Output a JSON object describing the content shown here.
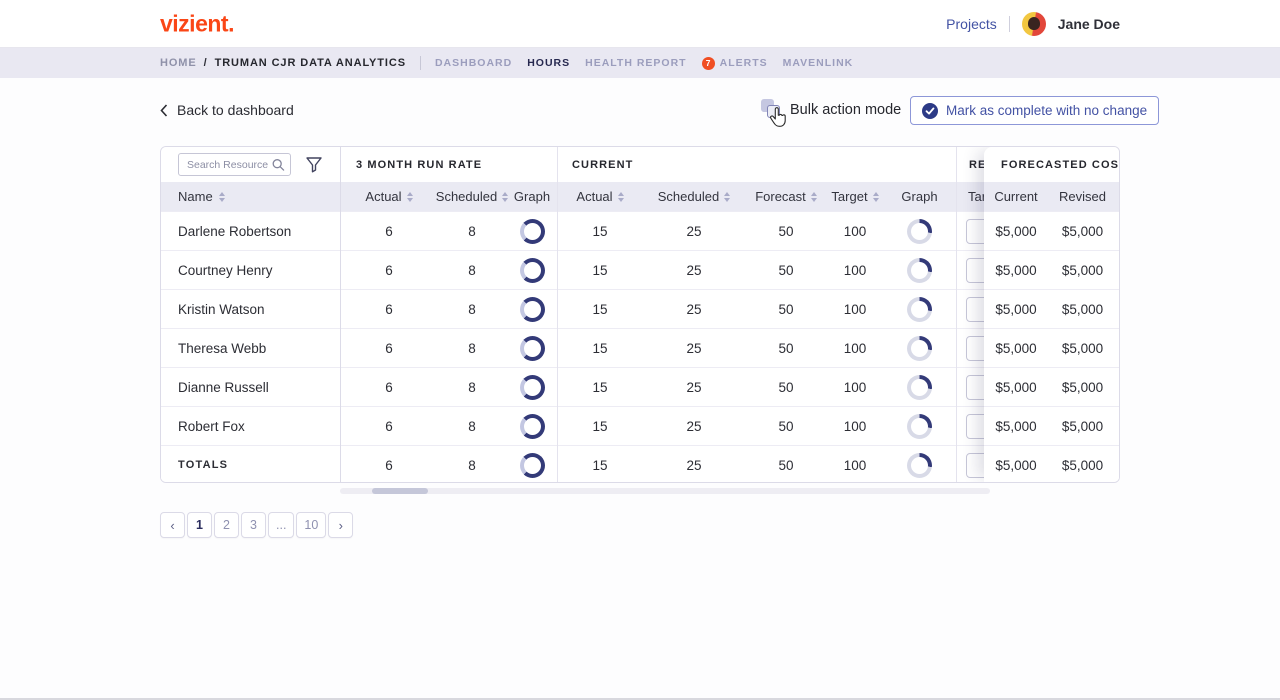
{
  "colors": {
    "brand_orange": "#fa4616",
    "badge_orange": "#f04e23",
    "accent_blue": "#4352a4",
    "active_nav": "#26284f",
    "donut_dark": "#333a78",
    "donut_light_rr": "#c3c7e2",
    "donut_light_cur": "#d8dae7",
    "header_lavender": "#eaeaf3",
    "subnav_lavender": "#e9e8f2"
  },
  "brand": {
    "logo": "vizient."
  },
  "topbar": {
    "projects": "Projects",
    "user": "Jane Doe"
  },
  "breadcrumb": {
    "home": "HOME",
    "separator": "/",
    "current": "TRUMAN CJR DATA ANALYTICS"
  },
  "nav": {
    "tabs": [
      {
        "label": "DASHBOARD"
      },
      {
        "label": "HOURS",
        "active": true
      },
      {
        "label": "HEALTH REPORT"
      },
      {
        "label": "ALERTS",
        "badge": "7"
      },
      {
        "label": "MAVENLINK"
      }
    ]
  },
  "toolbar": {
    "back_label": "Back to dashboard",
    "bulk_label": "Bulk action mode",
    "help_glyph": "?",
    "complete_label": "Mark as complete with no change"
  },
  "table": {
    "search_placeholder": "Search Resources",
    "name_header": "Name",
    "groups": {
      "run_rate": "3 MONTH RUN RATE",
      "current": "CURRENT",
      "revised": "REVISED",
      "forecasted_cost": "FORECASTED COST"
    },
    "mid_columns": [
      {
        "key": "rr_actual",
        "label": "Actual",
        "sortable": true
      },
      {
        "key": "rr_scheduled",
        "label": "Scheduled",
        "sortable": true
      },
      {
        "key": "rr_graph",
        "label": "Graph",
        "type": "donut_rr"
      },
      {
        "key": "cur_actual",
        "label": "Actual",
        "sortable": true
      },
      {
        "key": "cur_scheduled",
        "label": "Scheduled",
        "sortable": true
      },
      {
        "key": "cur_forecast",
        "label": "Forecast",
        "sortable": true
      },
      {
        "key": "cur_target",
        "label": "Target",
        "sortable": true
      },
      {
        "key": "cur_graph",
        "label": "Graph",
        "type": "donut_cur"
      },
      {
        "key": "rev_target",
        "label": "Target",
        "type": "input"
      }
    ],
    "panel_columns": [
      {
        "key": "cost_current",
        "label": "Current"
      },
      {
        "key": "cost_revised",
        "label": "Revised"
      }
    ],
    "donuts": {
      "run_rate_filled_pct": 75,
      "current_filled_pct": 27
    },
    "rows": [
      {
        "name": "Darlene Robertson",
        "rr_actual": "6",
        "rr_scheduled": "8",
        "cur_actual": "15",
        "cur_scheduled": "25",
        "cur_forecast": "50",
        "cur_target": "100",
        "cost_current": "$5,000",
        "cost_revised": "$5,000"
      },
      {
        "name": "Courtney Henry",
        "rr_actual": "6",
        "rr_scheduled": "8",
        "cur_actual": "15",
        "cur_scheduled": "25",
        "cur_forecast": "50",
        "cur_target": "100",
        "cost_current": "$5,000",
        "cost_revised": "$5,000"
      },
      {
        "name": "Kristin Watson",
        "rr_actual": "6",
        "rr_scheduled": "8",
        "cur_actual": "15",
        "cur_scheduled": "25",
        "cur_forecast": "50",
        "cur_target": "100",
        "cost_current": "$5,000",
        "cost_revised": "$5,000"
      },
      {
        "name": "Theresa Webb",
        "rr_actual": "6",
        "rr_scheduled": "8",
        "cur_actual": "15",
        "cur_scheduled": "25",
        "cur_forecast": "50",
        "cur_target": "100",
        "cost_current": "$5,000",
        "cost_revised": "$5,000"
      },
      {
        "name": "Dianne Russell",
        "rr_actual": "6",
        "rr_scheduled": "8",
        "cur_actual": "15",
        "cur_scheduled": "25",
        "cur_forecast": "50",
        "cur_target": "100",
        "cost_current": "$5,000",
        "cost_revised": "$5,000"
      },
      {
        "name": "Robert Fox",
        "rr_actual": "6",
        "rr_scheduled": "8",
        "cur_actual": "15",
        "cur_scheduled": "25",
        "cur_forecast": "50",
        "cur_target": "100",
        "cost_current": "$5,000",
        "cost_revised": "$5,000"
      }
    ],
    "totals": {
      "name": "TOTALS",
      "rr_actual": "6",
      "rr_scheduled": "8",
      "cur_actual": "15",
      "cur_scheduled": "25",
      "cur_forecast": "50",
      "cur_target": "100",
      "cost_current": "$5,000",
      "cost_revised": "$5,000"
    }
  },
  "pagination": {
    "prev": "‹",
    "next": "›",
    "pages": [
      {
        "label": "1",
        "active": true
      },
      {
        "label": "2"
      },
      {
        "label": "3"
      },
      {
        "label": "..."
      },
      {
        "label": "10"
      }
    ]
  }
}
